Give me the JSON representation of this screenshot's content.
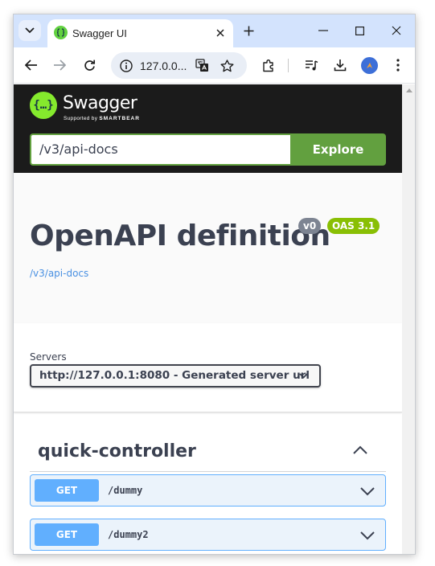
{
  "browser": {
    "tab_title": "Swagger UI",
    "address": "127.0.0...",
    "colors": {
      "tabstrip": "#d3e3fd",
      "omnibox": "#e9eef6"
    }
  },
  "swagger": {
    "logo_title": "Swagger",
    "logo_sub_prefix": "Supported by",
    "logo_sub_brand": "SMARTBEAR",
    "logo_glyph": "{…}",
    "url_value": "/v3/api-docs",
    "explore_label": "Explore",
    "colors": {
      "topbar": "#1b1b1b",
      "accent": "#62a03f",
      "get": "#61affe"
    }
  },
  "info": {
    "title": "OpenAPI definition",
    "version_badge": "v0",
    "oas_badge": "OAS 3.1",
    "link": "/v3/api-docs"
  },
  "servers": {
    "label": "Servers",
    "selected": "http://127.0.0.1:8080 - Generated server url"
  },
  "tag": {
    "name": "quick-controller"
  },
  "operations": [
    {
      "method": "GET",
      "path": "/dummy"
    },
    {
      "method": "GET",
      "path": "/dummy2"
    }
  ]
}
